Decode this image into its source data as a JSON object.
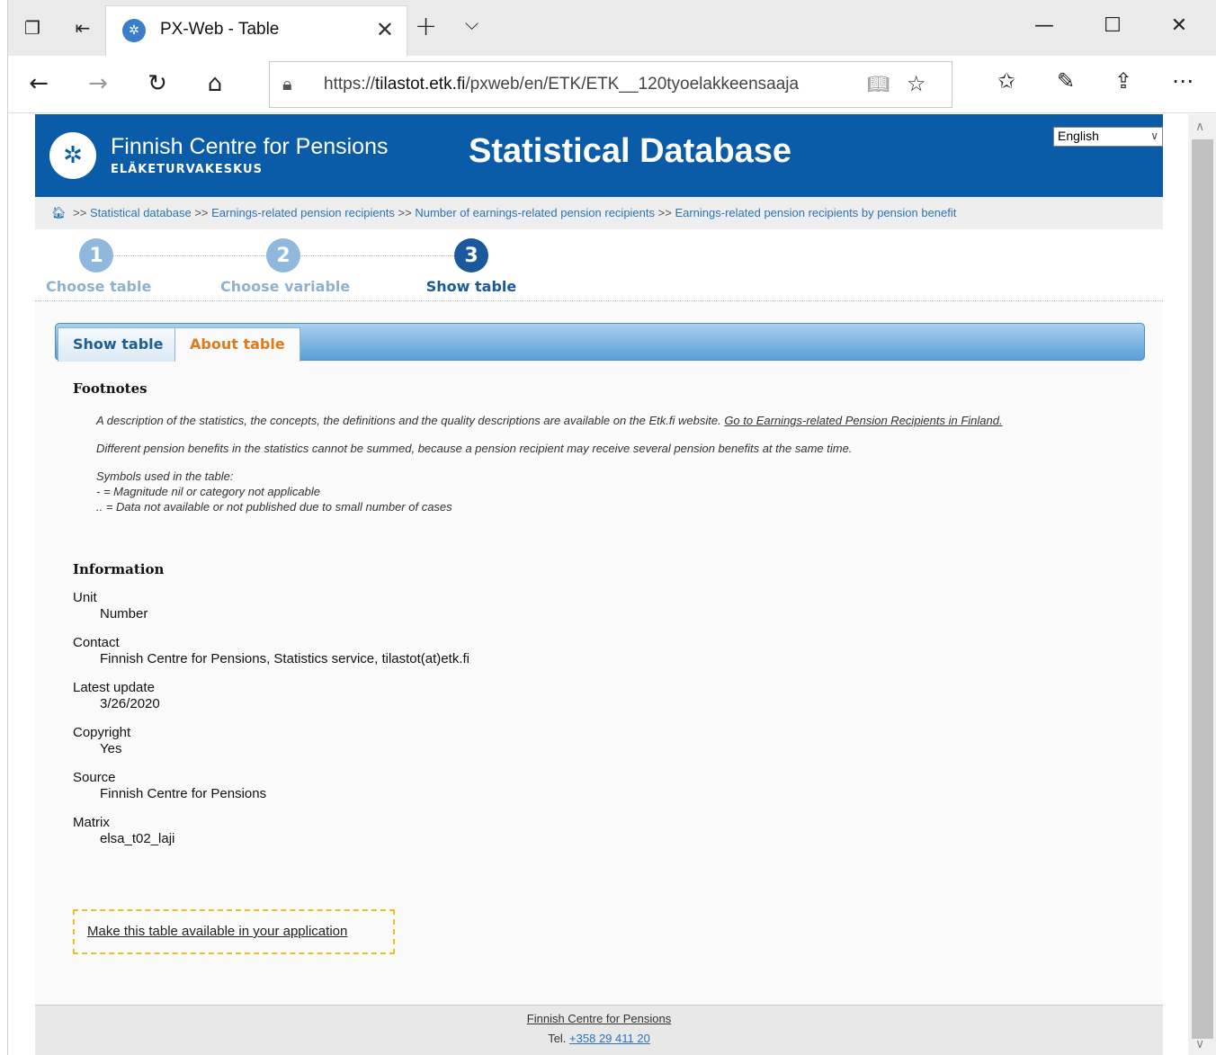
{
  "browser": {
    "tab_title": "PX-Web - Table",
    "url_prefix": "https://",
    "url_host": "tilastot.etk.fi",
    "url_path": "/pxweb/en/ETK/ETK__120tyoelakkeensaaja"
  },
  "header": {
    "org_name": "Finnish Centre for Pensions",
    "org_sub": "ELÄKETURVAKESKUS",
    "db_title": "Statistical Database",
    "language": "English"
  },
  "breadcrumb": {
    "sep": ">>",
    "items": [
      "Statistical database",
      "Earnings-related pension recipients",
      "Number of earnings-related pension recipients",
      "Earnings-related pension recipients by pension benefit"
    ]
  },
  "steps": [
    {
      "num": "1",
      "label": "Choose table"
    },
    {
      "num": "2",
      "label": "Choose variable"
    },
    {
      "num": "3",
      "label": "Show table"
    }
  ],
  "tabs": {
    "show": "Show table",
    "about": "About table"
  },
  "footnotes": {
    "title": "Footnotes",
    "p1_text": "A description of the statistics, the concepts, the definitions and the quality descriptions are available on the Etk.fi website. ",
    "p1_link": "Go to Earnings-related Pension Recipients in Finland.",
    "p2": "Different pension benefits in the statistics cannot be summed, because a pension recipient may receive several pension benefits at the same time.",
    "p3_l1": "Symbols used in the table:",
    "p3_l2": "- = Magnitude nil or category not applicable",
    "p3_l3": ".. = Data not available or not published due to small number of cases"
  },
  "information": {
    "title": "Information",
    "rows": [
      {
        "label": "Unit",
        "value": "Number"
      },
      {
        "label": "Contact",
        "value": "Finnish Centre for Pensions, Statistics service, tilastot(at)etk.fi"
      },
      {
        "label": "Latest update",
        "value": "3/26/2020"
      },
      {
        "label": "Copyright",
        "value": "Yes"
      },
      {
        "label": "Source",
        "value": "Finnish Centre for Pensions"
      },
      {
        "label": "Matrix",
        "value": "elsa_t02_laji"
      }
    ]
  },
  "api_link": "Make this table available in your application",
  "footer": {
    "org_link": "Finnish Centre for Pensions",
    "tel_label": "Tel.",
    "tel": "+358 29 411 20"
  }
}
